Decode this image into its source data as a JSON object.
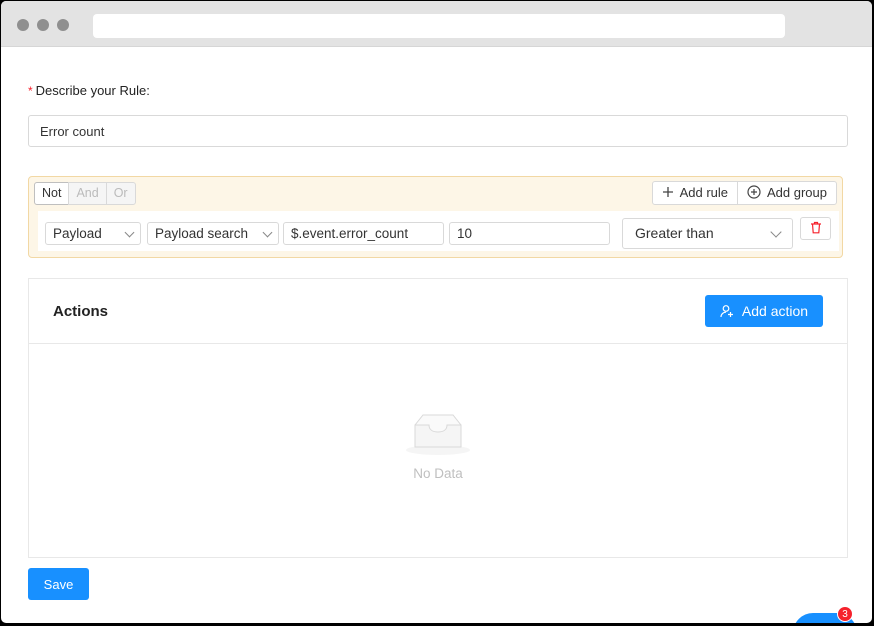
{
  "form": {
    "required_mark": "*",
    "label": "Describe your Rule",
    "label_colon": ":",
    "rule_name_value": "Error count"
  },
  "group": {
    "logic_options": [
      "Not",
      "And",
      "Or"
    ],
    "active_logic": "Not",
    "add_rule_label": "Add rule",
    "add_group_label": "Add group"
  },
  "rule": {
    "field_select": "Payload",
    "source_select": "Payload search",
    "path_value": "$.event.error_count",
    "compare_value": "10",
    "operator_select": "Greater than"
  },
  "actions": {
    "title": "Actions",
    "add_action_label": "Add action",
    "empty_text": "No Data"
  },
  "save_label": "Save",
  "chat": {
    "badge_count": "3"
  },
  "colors": {
    "primary": "#1890ff",
    "danger": "#f5222d",
    "group_bg": "#fdf6e7",
    "group_border": "#f2d8a4"
  },
  "icons": {
    "add_rule": "plus-icon",
    "add_group": "plus-circle-icon",
    "delete": "trash-icon",
    "add_action": "user-add-icon",
    "empty": "inbox-icon"
  }
}
